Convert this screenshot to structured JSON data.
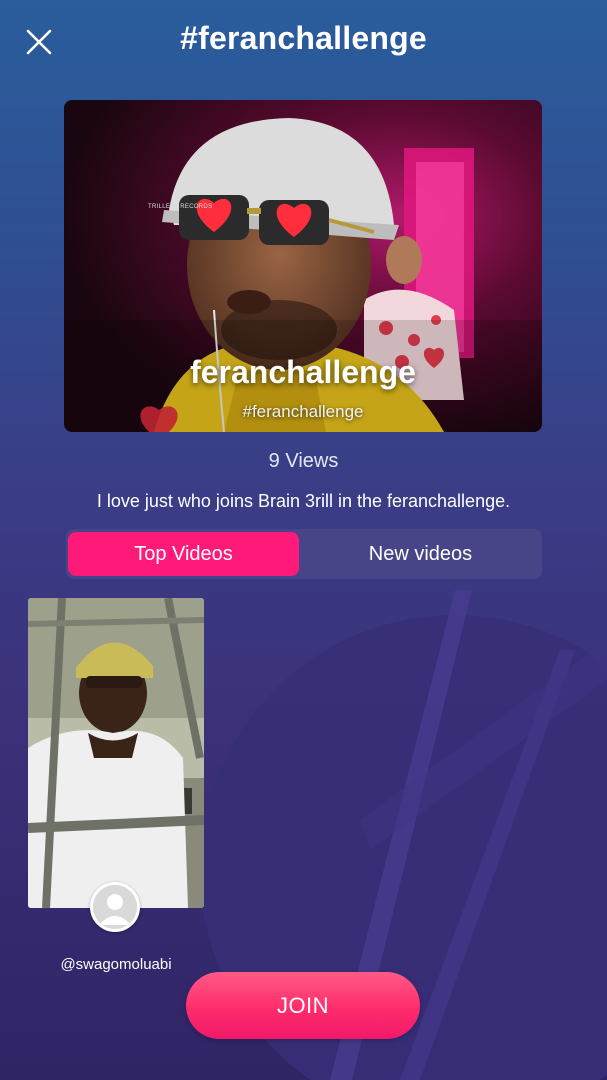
{
  "header": {
    "title": "#feranchallenge",
    "close_icon": "close-icon"
  },
  "banner": {
    "title": "feranchallenge",
    "hashtag": "#feranchallenge",
    "logo_text": "TRILLEST RECORDS"
  },
  "stats": {
    "views": "9 Views"
  },
  "description": "I love just who joins Brain 3rill in the feranchallenge.",
  "tabs": [
    {
      "label": "Top Videos",
      "active": true
    },
    {
      "label": "New videos",
      "active": false
    }
  ],
  "videos": [
    {
      "username": "@swagomoluabi",
      "avatar_icon": "default-user-icon"
    }
  ],
  "join_button": {
    "label": "JOIN"
  },
  "colors": {
    "accent": "#ff1a7a",
    "join": "#ff2c6c"
  }
}
